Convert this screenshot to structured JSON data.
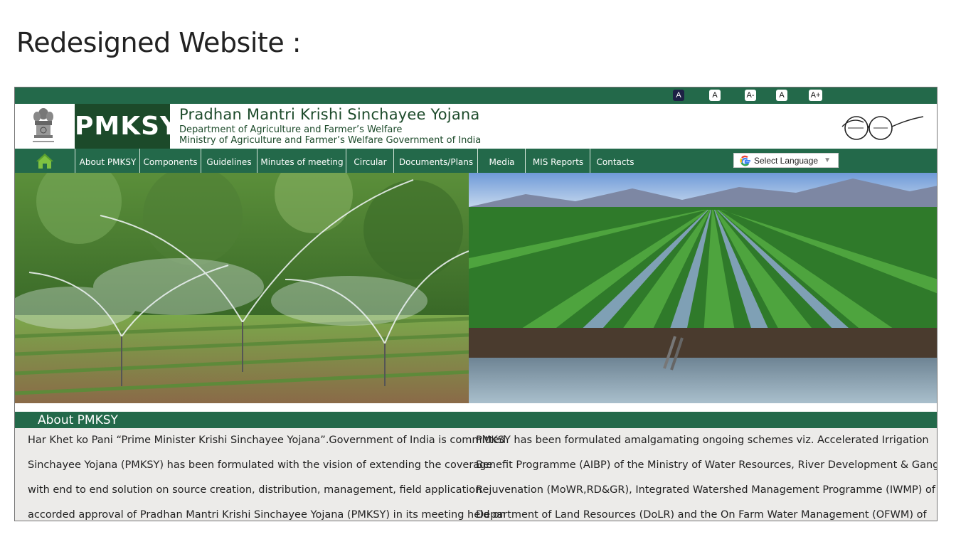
{
  "slide": {
    "title": "Redesigned Website :"
  },
  "font_controls": [
    "A",
    "A",
    "A-",
    "A",
    "A+"
  ],
  "header": {
    "logo_text": "PMKSY",
    "title": "Pradhan Mantri Krishi Sinchayee Yojana",
    "subtitle_line1": "Department of Agriculture and Farmer’s Welfare",
    "subtitle_line2": "Ministry of Agriculture and Farmer’s Welfare Government of India",
    "emblem_icon": "national-emblem-icon",
    "swachh_logo": "swachh-bharat-logo"
  },
  "nav": {
    "home_icon": "home-icon",
    "items": [
      {
        "label": "About PMKSY"
      },
      {
        "label": "Components"
      },
      {
        "label": "Guidelines"
      },
      {
        "label": "Minutes of meeting"
      },
      {
        "label": "Circular"
      },
      {
        "label": "Documents/Plans"
      },
      {
        "label": "Media"
      },
      {
        "label": "MIS Reports"
      },
      {
        "label": "Contacts"
      }
    ],
    "language_selector": "Select Language"
  },
  "about": {
    "heading": "About PMKSY",
    "left_lines": [
      "Har Khet ko Pani “Prime Minister Krishi Sinchayee Yojana”.Government of India is committed",
      "Sinchayee Yojana (PMKSY) has been formulated with the vision of extending the coverage",
      "with end to end solution on source creation, distribution, management, field application",
      "accorded approval of Pradhan Mantri Krishi Sinchayee Yojana (PMKSY) in its meeting held on"
    ],
    "right_lines": [
      "PMKSY has been formulated amalgamating ongoing schemes viz. Accelerated Irrigation",
      "Benefit Programme (AIBP) of the Ministry of Water Resources, River Development & Ganga",
      "Rejuvenation (MoWR,RD&GR), Integrated Watershed Management Programme (IWMP) of",
      "Department of Land Resources (DoLR) and the On Farm Water Management (OFWM) of"
    ]
  },
  "colors": {
    "primary_green": "#23694a",
    "logo_green": "#1c4a2a",
    "active_font_btn": "#1d2145"
  }
}
